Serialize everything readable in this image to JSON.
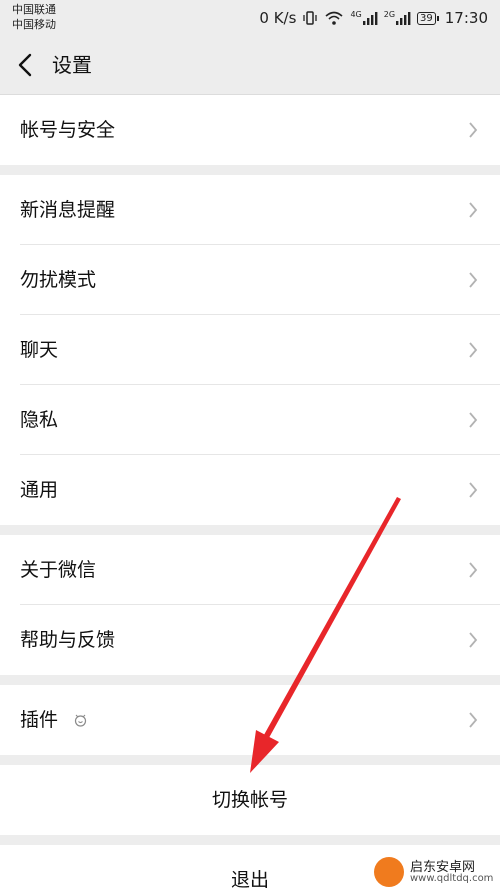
{
  "status_bar": {
    "carrier_1": "中国联通",
    "carrier_2": "中国移动",
    "speed": "0 K/s",
    "network_1": "4G",
    "network_2": "2G",
    "battery": "39",
    "time": "17:30"
  },
  "header": {
    "title": "设置"
  },
  "groups": [
    {
      "items": [
        {
          "label": "帐号与安全"
        }
      ]
    },
    {
      "items": [
        {
          "label": "新消息提醒"
        },
        {
          "label": "勿扰模式"
        },
        {
          "label": "聊天"
        },
        {
          "label": "隐私"
        },
        {
          "label": "通用"
        }
      ]
    },
    {
      "items": [
        {
          "label": "关于微信"
        },
        {
          "label": "帮助与反馈"
        }
      ]
    },
    {
      "items": [
        {
          "label": "插件"
        }
      ]
    }
  ],
  "actions": {
    "switch_account": "切换帐号",
    "logout": "退出"
  },
  "watermark": {
    "name": "启东安卓网",
    "url": "www.qdltdq.com"
  },
  "colors": {
    "background": "#ededed",
    "annotation_arrow": "#e8262a"
  }
}
